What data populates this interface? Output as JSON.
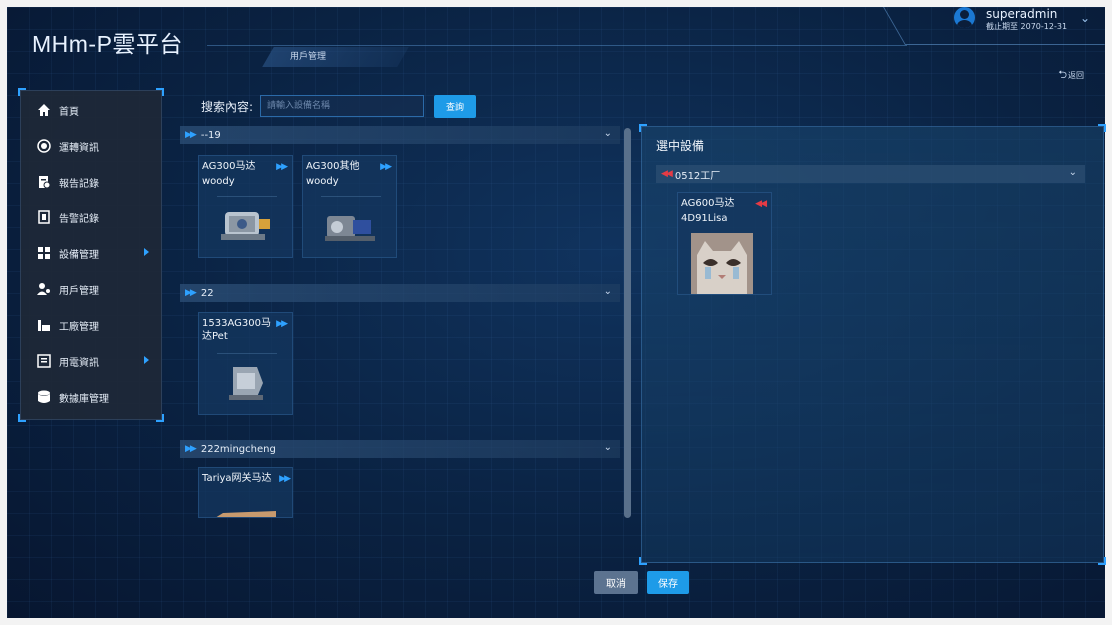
{
  "header": {
    "app_title": "MHm-P雲平台",
    "breadcrumb": "用戶管理",
    "user_name": "superadmin",
    "user_expiry": "截止期至 2070-12-31",
    "back_label": "返回"
  },
  "sidebar": {
    "items": [
      {
        "label": "首頁",
        "icon": "home-icon"
      },
      {
        "label": "運轉資訊",
        "icon": "operation-icon"
      },
      {
        "label": "報告記錄",
        "icon": "report-icon"
      },
      {
        "label": "告警記錄",
        "icon": "alarm-icon"
      },
      {
        "label": "設備管理",
        "icon": "device-icon"
      },
      {
        "label": "用戶管理",
        "icon": "users-icon"
      },
      {
        "label": "工廠管理",
        "icon": "factory-icon"
      },
      {
        "label": "用電資訊",
        "icon": "power-icon"
      },
      {
        "label": "數據庫管理",
        "icon": "database-icon"
      }
    ]
  },
  "search": {
    "label": "搜索內容:",
    "placeholder": "請輸入設備名稱",
    "button": "查詢"
  },
  "groups": [
    {
      "name": "--19",
      "devices": [
        {
          "name": "AG300马达",
          "owner": "woody"
        },
        {
          "name": "AG300其他",
          "owner": "woody"
        }
      ]
    },
    {
      "name": "22",
      "devices": [
        {
          "name": "1533AG300马达Pet",
          "owner": ""
        }
      ]
    },
    {
      "name": "222mingcheng",
      "devices": [
        {
          "name": "Tariya网关马达",
          "owner": ""
        }
      ]
    }
  ],
  "selected": {
    "title": "選中設備",
    "group_name": "0512工厂",
    "device_name": "AG600马达",
    "device_owner": "4D91Lisa"
  },
  "actions": {
    "cancel": "取消",
    "save": "保存"
  },
  "colors": {
    "accent": "#1e9be8",
    "arrow_blue": "#2ea1ff",
    "arrow_red": "#e53b45",
    "background": "#0b1e3a"
  }
}
